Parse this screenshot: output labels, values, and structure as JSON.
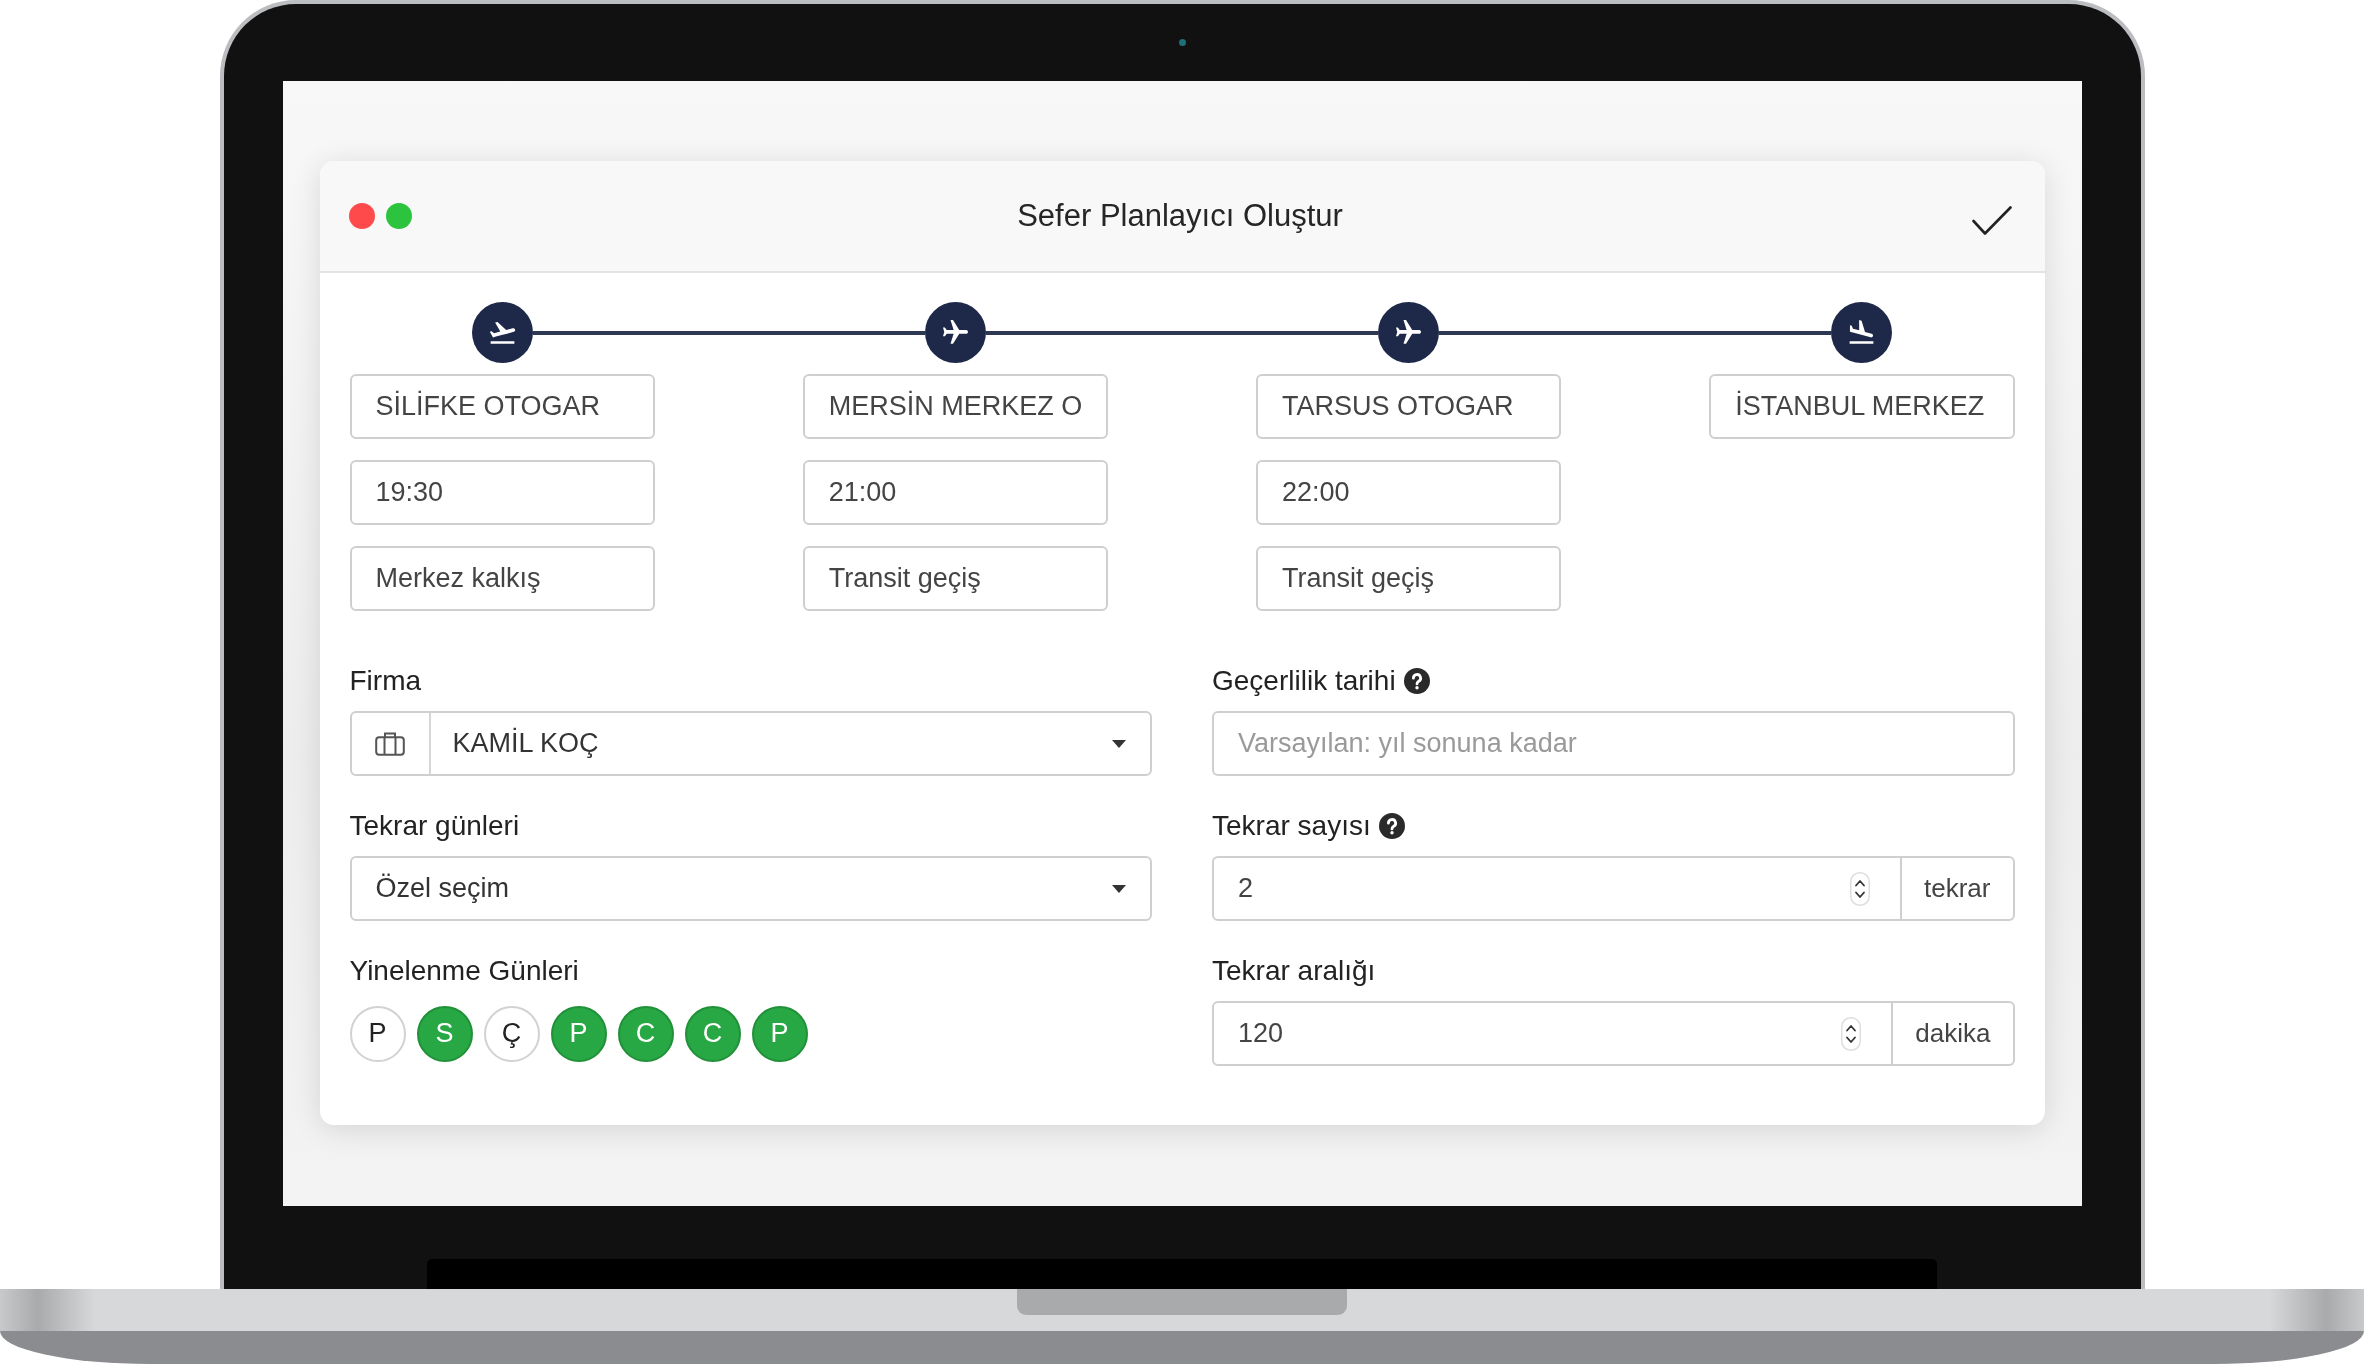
{
  "window": {
    "title": "Sefer Planlayıcı Oluştur"
  },
  "route": {
    "stops": [
      {
        "kind": "departure",
        "name": "SİLİFKE OTOGAR",
        "time": "19:30",
        "note": "Merkez kalkış"
      },
      {
        "kind": "transit",
        "name": "MERSİN MERKEZ O",
        "time": "21:00",
        "note": "Transit geçiş"
      },
      {
        "kind": "transit",
        "name": "TARSUS OTOGAR",
        "time": "22:00",
        "note": "Transit geçiş"
      },
      {
        "kind": "arrival",
        "name": "İSTANBUL MERKEZ"
      }
    ]
  },
  "form": {
    "company": {
      "label": "Firma",
      "value": "KAMİL KOÇ"
    },
    "valid_until": {
      "label": "Geçerlilik tarihi",
      "help": true,
      "placeholder": "Varsayılan: yıl sonuna kadar"
    },
    "repeat_days": {
      "label": "Tekrar günleri",
      "value": "Özel seçim"
    },
    "repeat_count": {
      "label": "Tekrar sayısı",
      "help": true,
      "value": "2",
      "unit": "tekrar"
    },
    "recurrence_days": {
      "label": "Yinelenme Günleri",
      "days": [
        {
          "label": "P",
          "selected": false
        },
        {
          "label": "S",
          "selected": true
        },
        {
          "label": "Ç",
          "selected": false
        },
        {
          "label": "P",
          "selected": true
        },
        {
          "label": "C",
          "selected": true
        },
        {
          "label": "C",
          "selected": true
        },
        {
          "label": "P",
          "selected": true
        }
      ]
    },
    "repeat_interval": {
      "label": "Tekrar aralığı",
      "help": false,
      "value": "120",
      "unit": "dakika"
    }
  }
}
